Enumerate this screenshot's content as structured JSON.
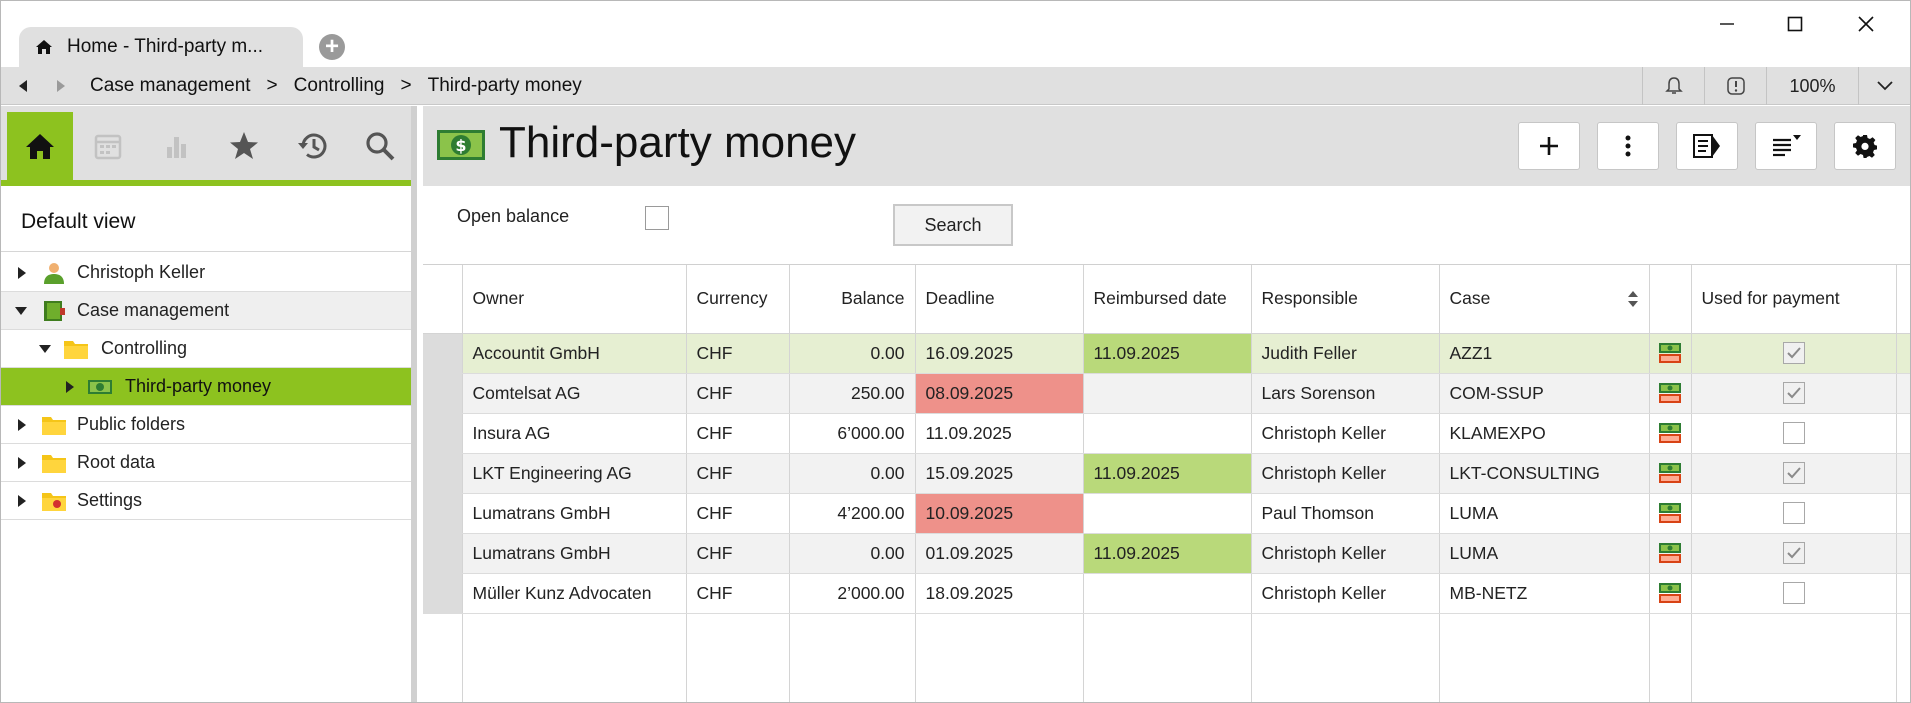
{
  "app": {
    "tab_title": "Home - Third-party m...",
    "new_tab_icon": "plus-icon",
    "window_controls": [
      "minimize-icon",
      "maximize-icon",
      "close-icon"
    ]
  },
  "breadcrumb": {
    "items": [
      "Case management",
      "Controlling",
      "Third-party money"
    ],
    "separator": ">",
    "zoom": "100%"
  },
  "sidebar": {
    "tabs": [
      "home-icon",
      "calendar-icon",
      "bar-chart-icon",
      "star-icon",
      "history-icon",
      "search-icon"
    ],
    "view_title": "Default view",
    "tree": [
      {
        "label": "Christoph Keller",
        "icon": "user-icon",
        "expanded": false
      },
      {
        "label": "Case management",
        "icon": "case-binder-icon",
        "expanded": true
      },
      {
        "label": "Controlling",
        "icon": "folder-icon",
        "expanded": true
      },
      {
        "label": "Third-party money",
        "icon": "money-icon",
        "expanded": false,
        "selected": true
      },
      {
        "label": "Public folders",
        "icon": "folder-icon",
        "expanded": false
      },
      {
        "label": "Root data",
        "icon": "folder-icon",
        "expanded": false
      },
      {
        "label": "Settings",
        "icon": "settings-folder-icon",
        "expanded": false
      }
    ]
  },
  "main": {
    "title": "Third-party money",
    "toolbar": [
      "add-icon",
      "more-vertical-icon",
      "detail-panel-icon",
      "list-sort-icon",
      "settings-gear-icon"
    ],
    "filter": {
      "open_balance_label": "Open balance",
      "open_balance_checked": false,
      "search_label": "Search"
    },
    "table": {
      "headers": [
        "Owner",
        "Currency",
        "Balance",
        "Deadline",
        "Reimbursed date",
        "Responsible",
        "Case",
        "",
        "Used for payment"
      ],
      "rows": [
        {
          "owner": "Accountit GmbH",
          "currency": "CHF",
          "balance": "0.00",
          "deadline": "16.09.2025",
          "reimbursed": "11.09.2025",
          "responsible": "Judith Feller",
          "case": "AZZ1",
          "used": true
        },
        {
          "owner": "Comtelsat AG",
          "currency": "CHF",
          "balance": "250.00",
          "deadline": "08.09.2025",
          "reimbursed": "",
          "responsible": "Lars Sorenson",
          "case": "COM-SSUP",
          "used": true
        },
        {
          "owner": "Insura AG",
          "currency": "CHF",
          "balance": "6’000.00",
          "deadline": "11.09.2025",
          "reimbursed": "",
          "responsible": "Christoph Keller",
          "case": "KLAMEXPO",
          "used": false
        },
        {
          "owner": "LKT Engineering AG",
          "currency": "CHF",
          "balance": "0.00",
          "deadline": "15.09.2025",
          "reimbursed": "11.09.2025",
          "responsible": "Christoph Keller",
          "case": "LKT-CONSULTING",
          "used": true
        },
        {
          "owner": "Lumatrans GmbH",
          "currency": "CHF",
          "balance": "4’200.00",
          "deadline": "10.09.2025",
          "reimbursed": "",
          "responsible": "Paul Thomson",
          "case": "LUMA",
          "used": false
        },
        {
          "owner": "Lumatrans GmbH",
          "currency": "CHF",
          "balance": "0.00",
          "deadline": "01.09.2025",
          "reimbursed": "11.09.2025",
          "responsible": "Christoph Keller",
          "case": "LUMA",
          "used": true
        },
        {
          "owner": "Müller Kunz Advocaten",
          "currency": "CHF",
          "balance": "2’000.00",
          "deadline": "18.09.2025",
          "reimbursed": "",
          "responsible": "Christoph Keller",
          "case": "MB-NETZ",
          "used": false
        }
      ],
      "overdue_color": "#ee918a",
      "reimbursed_color": "#b9d97a",
      "selected_row_color": "#e6efd2"
    }
  },
  "colors": {
    "accent": "#8dc21f",
    "chrome": "#e0e0e0"
  }
}
